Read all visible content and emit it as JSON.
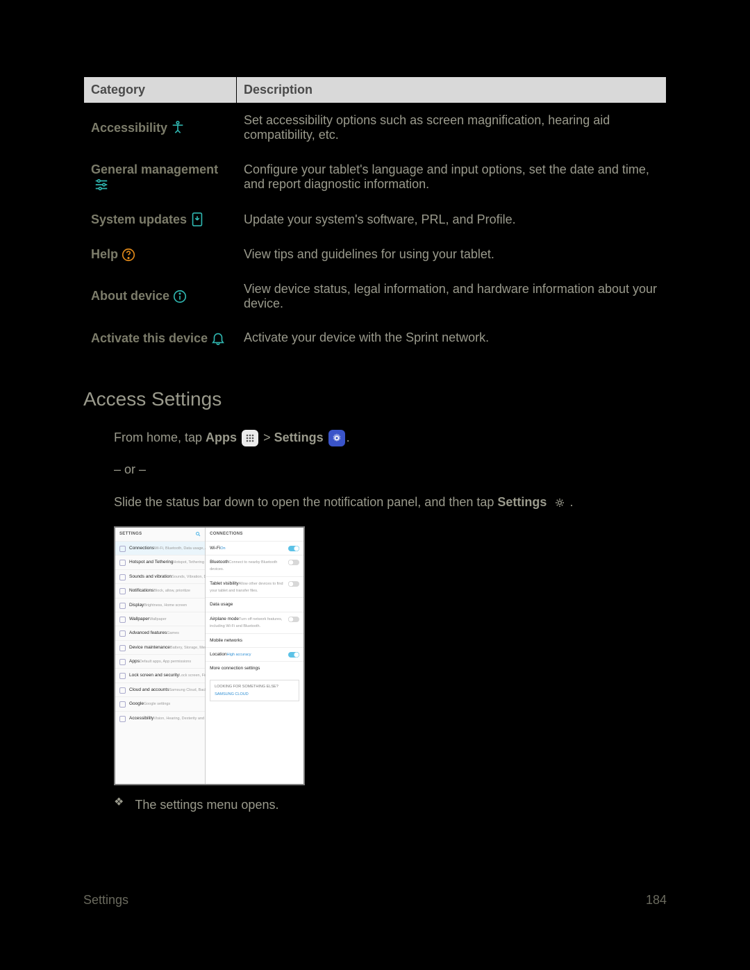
{
  "table": {
    "header_category": "Category",
    "header_description": "Description",
    "rows": [
      {
        "category": "Accessibility",
        "icon": "accessibility-icon",
        "color": "teal",
        "description": "Set accessibility options such as screen magnification, hearing aid compatibility, etc."
      },
      {
        "category": "General management",
        "icon": "sliders-icon",
        "color": "teal",
        "description": "Configure your tablet's language and input options, set the date and time, and report diagnostic information."
      },
      {
        "category": "System updates",
        "icon": "system-update-icon",
        "color": "teal",
        "description": "Update your system's software, PRL, and Profile."
      },
      {
        "category": "Help",
        "icon": "help-icon",
        "color": "orange",
        "description": "View tips and guidelines for using your tablet."
      },
      {
        "category": "About device",
        "icon": "info-icon",
        "color": "teal",
        "description": "View device status, legal information, and hardware information about your device."
      },
      {
        "category": "Activate this device",
        "icon": "bell-icon",
        "color": "teal",
        "description": "Activate your device with the Sprint network."
      }
    ]
  },
  "access_heading": "Access Settings",
  "instr": {
    "prefix": "From home, tap ",
    "apps_label": "Apps",
    "sep1": " > ",
    "settings_label": "Settings",
    "suffix": ".",
    "or": "– or –",
    "line2_prefix": "Slide the status bar down to open the notification panel, and then tap ",
    "line2_settings": "Settings",
    "line2_suffix": "."
  },
  "result_bullet": "The settings menu opens.",
  "screenshot": {
    "left_header": "SETTINGS",
    "right_header": "CONNECTIONS",
    "left_items": [
      {
        "title": "Connections",
        "sub": "Wi-Fi, Bluetooth, Data usage, Airplane m…",
        "selected": true
      },
      {
        "title": "Hotspot and Tethering",
        "sub": "Hotspot, Tethering"
      },
      {
        "title": "Sounds and vibration",
        "sub": "Sounds, Vibration, Do not disturb"
      },
      {
        "title": "Notifications",
        "sub": "Block, allow, prioritize"
      },
      {
        "title": "Display",
        "sub": "Brightness, Home screen"
      },
      {
        "title": "Wallpaper",
        "sub": "Wallpaper"
      },
      {
        "title": "Advanced features",
        "sub": "Games"
      },
      {
        "title": "Device maintenance",
        "sub": "Battery, Storage, Memory"
      },
      {
        "title": "Apps",
        "sub": "Default apps, App permissions"
      },
      {
        "title": "Lock screen and security",
        "sub": "Lock screen, Fingerprints"
      },
      {
        "title": "Cloud and accounts",
        "sub": "Samsung Cloud, Backup and restore"
      },
      {
        "title": "Google",
        "sub": "Google settings"
      },
      {
        "title": "Accessibility",
        "sub": "Vision, Hearing, Dexterity and interaction"
      }
    ],
    "right_items": [
      {
        "title": "Wi-Fi",
        "sub": "On",
        "accent": true,
        "toggle": "on"
      },
      {
        "title": "Bluetooth",
        "sub": "Connect to nearby Bluetooth devices.",
        "toggle": "off"
      },
      {
        "title": "Tablet visibility",
        "sub": "Allow other devices to find your tablet and transfer files.",
        "toggle": "off"
      },
      {
        "title": "Data usage"
      },
      {
        "title": "Airplane mode",
        "sub": "Turn off network features, including Wi-Fi and Bluetooth.",
        "toggle": "off"
      },
      {
        "title": "Mobile networks"
      },
      {
        "title": "Location",
        "sub": "High accuracy",
        "accent": true,
        "toggle": "on"
      },
      {
        "title": "More connection settings"
      }
    ],
    "looking_header": "LOOKING FOR SOMETHING ELSE?",
    "looking_link": "SAMSUNG CLOUD"
  },
  "footer_left": "Settings",
  "footer_right": "184"
}
